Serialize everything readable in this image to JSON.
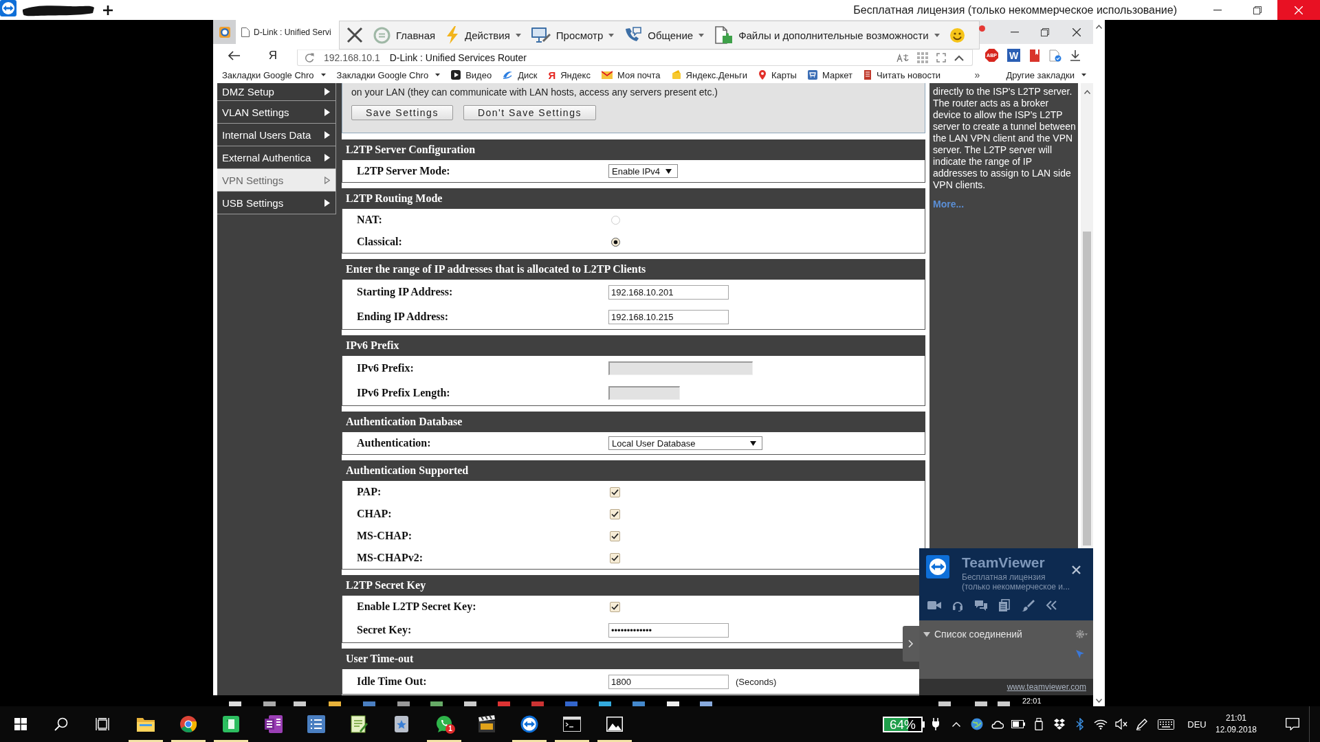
{
  "remote_window": {
    "title": "Бесплатная лицензия (только некоммерческое использование)"
  },
  "remote_toolbar": {
    "items": [
      {
        "kind": "close"
      },
      {
        "kind": "home",
        "label": "Главная",
        "menu": false
      },
      {
        "kind": "actions",
        "label": "Действия",
        "menu": true
      },
      {
        "kind": "view",
        "label": "Просмотр",
        "menu": true
      },
      {
        "kind": "communicate",
        "label": "Общение",
        "menu": true
      },
      {
        "kind": "files",
        "label": "Файлы и дополнительные возможности",
        "menu": true
      },
      {
        "kind": "feedback"
      }
    ]
  },
  "browser": {
    "tab": {
      "title": "D-Link : Unified Servi"
    },
    "home_button": "Я",
    "address": {
      "host": "192.168.10.1",
      "page_title": "D-Link : Unified Services Router"
    },
    "extensions": [
      {
        "kind": "adblock",
        "glyph": "ABP"
      },
      {
        "kind": "word",
        "glyph": "W"
      },
      {
        "kind": "bookmark"
      },
      {
        "kind": "shield"
      }
    ],
    "bookmarks": [
      {
        "kind": "folder",
        "label": "Закладки Google Chro",
        "menu": true
      },
      {
        "kind": "folder",
        "label": "Закладки Google Chro",
        "menu": true
      },
      {
        "kind": "video",
        "label": "Видео",
        "menu": false
      },
      {
        "kind": "disk",
        "label": "Диск",
        "menu": false
      },
      {
        "kind": "yandex",
        "glyph": "Я",
        "label": "Яндекс",
        "menu": false
      },
      {
        "kind": "mail",
        "label": "Моя почта",
        "menu": false
      },
      {
        "kind": "money",
        "label": "Яндекс.Деньги",
        "menu": false
      },
      {
        "kind": "maps",
        "label": "Карты",
        "menu": false
      },
      {
        "kind": "market",
        "label": "Маркет",
        "menu": false
      },
      {
        "kind": "news",
        "label": "Читать новости",
        "menu": false
      }
    ],
    "bookmarks_overflow": "»",
    "other_bookmarks": {
      "label": "Другие закладки",
      "menu": true
    }
  },
  "page": {
    "sidebar": {
      "items": [
        {
          "label": "DMZ Setup",
          "selected": false
        },
        {
          "label": "VLAN Settings",
          "selected": false
        },
        {
          "label": "Internal Users Data",
          "selected": false
        },
        {
          "label": "External Authentica",
          "selected": false
        },
        {
          "label": "VPN Settings",
          "selected": true
        },
        {
          "label": "USB Settings",
          "selected": false
        }
      ]
    },
    "intro": {
      "text": "on your LAN (they can communicate with LAN hosts, access any servers present etc.)",
      "buttons": [
        "Save Settings",
        "Don't Save Settings"
      ]
    },
    "sections": [
      {
        "title": "L2TP Server Configuration",
        "rows": [
          {
            "kind": "select",
            "label": "L2TP Server Mode:",
            "value": "Enable IPv4"
          }
        ]
      },
      {
        "title": "L2TP Routing Mode",
        "rows": [
          {
            "kind": "radio",
            "label": "NAT:",
            "selected": false
          },
          {
            "kind": "radio",
            "label": "Classical:",
            "selected": true
          }
        ]
      },
      {
        "title": "Enter the range of IP addresses that is allocated to L2TP Clients",
        "rows": [
          {
            "kind": "text",
            "label": "Starting IP Address:",
            "value": "192.168.10.201",
            "disabled": false
          },
          {
            "kind": "text",
            "label": "Ending IP Address:",
            "value": "192.168.10.215",
            "disabled": false
          }
        ]
      },
      {
        "title": "IPv6 Prefix",
        "rows": [
          {
            "kind": "text",
            "label": "IPv6 Prefix:",
            "disabled": true
          },
          {
            "kind": "text",
            "label": "IPv6 Prefix Length:",
            "disabled": true
          }
        ]
      },
      {
        "title": "Authentication Database",
        "rows": [
          {
            "kind": "select",
            "label": "Authentication:",
            "value": "Local User Database"
          }
        ]
      },
      {
        "title": "Authentication Supported",
        "rows": [
          {
            "kind": "checkbox",
            "label": "PAP:",
            "checked": true
          },
          {
            "kind": "checkbox",
            "label": "CHAP:",
            "checked": true
          },
          {
            "kind": "checkbox",
            "label": "MS-CHAP:",
            "checked": true
          },
          {
            "kind": "checkbox",
            "label": "MS-CHAPv2:",
            "checked": true
          }
        ]
      },
      {
        "title": "L2TP Secret Key",
        "rows": [
          {
            "kind": "checkbox",
            "label": "Enable L2TP Secret Key:",
            "checked": true
          },
          {
            "kind": "password",
            "label": "Secret Key:",
            "value": "•••••••••••••",
            "disabled": false
          }
        ]
      },
      {
        "title": "User Time-out",
        "rows": [
          {
            "kind": "text",
            "label": "Idle Time Out:",
            "value": "1800",
            "unit": "(Seconds)",
            "disabled": false
          }
        ]
      }
    ],
    "help": {
      "text": "directly to the ISP's L2TP server. The router acts as a broker device to allow the ISP's L2TP server to create a tunnel between the LAN VPN client and the VPN server. The L2TP server will indicate the range of IP addresses to assign to LAN side VPN clients.",
      "link": "More..."
    }
  },
  "teamviewer_panel": {
    "product": "TeamViewer",
    "license_lines": [
      "Бесплатная лицензия",
      "(только некоммерческое и..."
    ],
    "tools": [
      {
        "kind": "video"
      },
      {
        "kind": "audio"
      },
      {
        "kind": "chat"
      },
      {
        "kind": "files"
      },
      {
        "kind": "whiteboard"
      },
      {
        "kind": "collapse"
      }
    ],
    "connections": {
      "label": "Список соединений",
      "expanded": true
    },
    "link": "www.teamviewer.com"
  },
  "remote_taskbar": {
    "clock": "22:01"
  },
  "taskbar": {
    "apps": [
      {
        "kind": "explorer",
        "running": true
      },
      {
        "kind": "chrome",
        "running": true
      },
      {
        "kind": "evernote",
        "running": true
      },
      {
        "kind": "onenote",
        "running": false
      },
      {
        "kind": "tasks",
        "running": false
      },
      {
        "kind": "notepad",
        "running": false
      },
      {
        "kind": "utility",
        "running": false
      },
      {
        "kind": "whatsapp",
        "running": true,
        "badge": "1"
      },
      {
        "kind": "video_editor",
        "running": false
      },
      {
        "kind": "teamviewer",
        "running": true
      },
      {
        "kind": "terminal",
        "running": true
      },
      {
        "kind": "photos",
        "running": true
      }
    ],
    "battery": {
      "label": "64%",
      "level": 0.64
    },
    "tray": [
      {
        "kind": "power"
      },
      {
        "kind": "show_hidden"
      },
      {
        "kind": "globe"
      },
      {
        "kind": "cloud"
      },
      {
        "kind": "battery"
      },
      {
        "kind": "usb"
      },
      {
        "kind": "dropbox"
      },
      {
        "kind": "bluetooth"
      },
      {
        "kind": "wifi"
      },
      {
        "kind": "volume_muted"
      },
      {
        "kind": "pen"
      },
      {
        "kind": "keyboard"
      }
    ],
    "language": "DEU",
    "time": "21:01",
    "date": "12.09.2018"
  }
}
